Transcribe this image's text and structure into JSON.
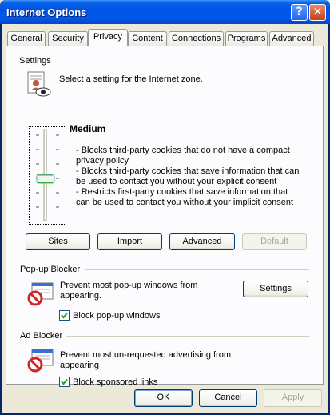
{
  "window": {
    "title": "Internet Options"
  },
  "tabs": [
    {
      "label": "General"
    },
    {
      "label": "Security"
    },
    {
      "label": "Privacy",
      "active": true
    },
    {
      "label": "Content"
    },
    {
      "label": "Connections"
    },
    {
      "label": "Programs"
    },
    {
      "label": "Advanced"
    }
  ],
  "settings": {
    "group_label": "Settings",
    "intro": "Select a setting for the Internet zone.",
    "level": "Medium",
    "description_lines": [
      "- Blocks third-party cookies that do not have a compact",
      "privacy policy",
      "- Blocks third-party cookies that save information that can",
      "be used to contact you without your explicit consent",
      "- Restricts first-party cookies that save information that",
      "can be used to contact you without your implicit consent"
    ],
    "buttons": {
      "sites": "Sites",
      "import": "Import",
      "advanced": "Advanced",
      "default": "Default"
    }
  },
  "popup_blocker": {
    "group_label": "Pop-up Blocker",
    "text_lines": [
      "Prevent most pop-up windows from",
      "appearing."
    ],
    "settings_button": "Settings",
    "checkbox_label": "Block pop-up windows",
    "checked": true
  },
  "ad_blocker": {
    "group_label": "Ad Blocker",
    "text_lines": [
      "Prevent most un-requested advertising from",
      "appearing"
    ],
    "checkbox_label": "Block sponsored links",
    "checked": true
  },
  "footer": {
    "ok": "OK",
    "cancel": "Cancel",
    "apply": "Apply"
  },
  "colors": {
    "title_bar": "#0054e3",
    "active_tab_accent": "#e68b2c",
    "dialog_bg": "#ece9d8"
  }
}
